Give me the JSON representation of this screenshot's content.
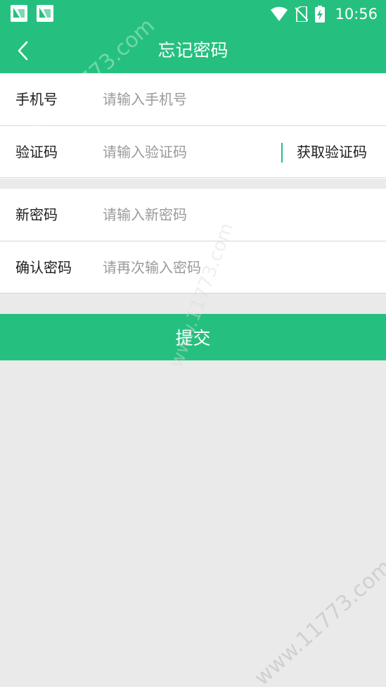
{
  "status_bar": {
    "time": "10:56",
    "icons": [
      "app-notification-icon",
      "app-notification-icon",
      "wifi-icon",
      "no-sim-icon",
      "battery-charging-icon"
    ]
  },
  "header": {
    "title": "忘记密码",
    "back_icon": "chevron-left-icon"
  },
  "form": {
    "phone": {
      "label": "手机号",
      "placeholder": "请输入手机号",
      "value": ""
    },
    "code": {
      "label": "验证码",
      "placeholder": "请输入验证码",
      "value": "",
      "get_code_label": "获取验证码"
    },
    "new_password": {
      "label": "新密码",
      "placeholder": "请输入新密码",
      "value": ""
    },
    "confirm_password": {
      "label": "确认密码",
      "placeholder": "请再次输入密码",
      "value": ""
    }
  },
  "submit_label": "提交",
  "watermark": "www.11773.com",
  "colors": {
    "brand": "#25c07f",
    "background": "#eaeaea",
    "surface": "#ffffff",
    "placeholder": "#9a9a9a"
  }
}
